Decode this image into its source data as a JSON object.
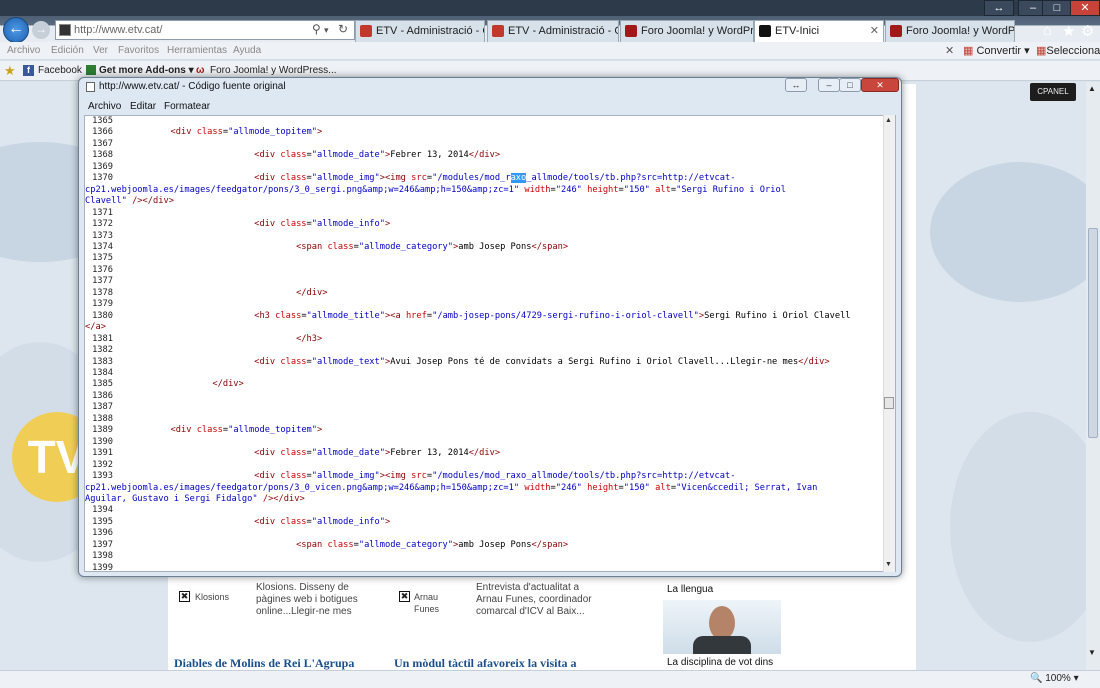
{
  "browser": {
    "address": "http://www.etv.cat/",
    "tabs": [
      {
        "label": "ETV - Administració - Ges...",
        "icon_color": "#c0392b",
        "active": false
      },
      {
        "label": "ETV - Administració - Ges...",
        "icon_color": "#c0392b",
        "active": false
      },
      {
        "label": "Foro Joomla! y WordPress...",
        "icon_color": "#a01818",
        "active": false
      },
      {
        "label": "ETV-Inici",
        "icon_color": "#111111",
        "active": true
      },
      {
        "label": "Foro Joomla! y WordPress...",
        "icon_color": "#a01818",
        "active": false
      }
    ],
    "menu": [
      "Archivo",
      "Edición",
      "Ver",
      "Favoritos",
      "Herramientas",
      "Ayuda"
    ],
    "favorites": [
      "Facebook",
      "Get more Add-ons ▾",
      "Foro Joomla! y WordPress..."
    ],
    "commands": {
      "convert": "Convertir ▾",
      "select": "Seleccionar"
    },
    "zoom": "100%"
  },
  "source_window": {
    "title": "http://www.etv.cat/ - Código fuente original",
    "menu": [
      "Archivo",
      "Editar",
      "Formatear"
    ],
    "lines": [
      {
        "n": "1365",
        "html": ""
      },
      {
        "n": "1366",
        "html": "        <span class=\"t\">&lt;div</span> <span class=\"a\">class</span>=<span class=\"v\">\"allmode_topitem\"</span><span class=\"t\">&gt;</span>"
      },
      {
        "n": "1367",
        "html": ""
      },
      {
        "n": "1368",
        "html": "                        <span class=\"t\">&lt;div</span> <span class=\"a\">class</span>=<span class=\"v\">\"allmode_date\"</span><span class=\"t\">&gt;</span>Febrer 13, 2014<span class=\"t\">&lt;/div&gt;</span>"
      },
      {
        "n": "1369",
        "html": ""
      },
      {
        "n": "1370",
        "html": "                        <span class=\"t\">&lt;div</span> <span class=\"a\">class</span>=<span class=\"v\">\"allmode_img\"</span><span class=\"t\">&gt;&lt;img</span> <span class=\"a\">src</span>=<span class=\"v\">\"/modules/mod_r<span class=\"sel\">axo</span>_allmode/tools/tb.php?src=http://etvcat-</span>"
      },
      {
        "n": "",
        "html": "<span class=\"v\">cp21.webjoomla.es/images/feedgator/pons/3_0_sergi.png&amp;amp;w=246&amp;amp;h=150&amp;amp;zc=1\"</span> <span class=\"a\">width</span>=<span class=\"v\">\"246\"</span> <span class=\"a\">height</span>=<span class=\"v\">\"150\"</span> <span class=\"a\">alt</span>=<span class=\"v\">\"Sergi Rufino i Oriol</span>"
      },
      {
        "n": "",
        "html": "<span class=\"v\">Clavell\"</span> <span class=\"t\">/&gt;&lt;/div&gt;</span>"
      },
      {
        "n": "1371",
        "html": ""
      },
      {
        "n": "1372",
        "html": "                        <span class=\"t\">&lt;div</span> <span class=\"a\">class</span>=<span class=\"v\">\"allmode_info\"</span><span class=\"t\">&gt;</span>"
      },
      {
        "n": "1373",
        "html": ""
      },
      {
        "n": "1374",
        "html": "                                <span class=\"t\">&lt;span</span> <span class=\"a\">class</span>=<span class=\"v\">\"allmode_category\"</span><span class=\"t\">&gt;</span>amb Josep Pons<span class=\"t\">&lt;/span&gt;</span>"
      },
      {
        "n": "1375",
        "html": ""
      },
      {
        "n": "1376",
        "html": ""
      },
      {
        "n": "1377",
        "html": ""
      },
      {
        "n": "1378",
        "html": "                                <span class=\"t\">&lt;/div&gt;</span>"
      },
      {
        "n": "1379",
        "html": ""
      },
      {
        "n": "1380",
        "html": "                        <span class=\"t\">&lt;h3</span> <span class=\"a\">class</span>=<span class=\"v\">\"allmode_title\"</span><span class=\"t\">&gt;&lt;a</span> <span class=\"a\">href</span>=<span class=\"v\">\"/amb-josep-pons/4729-sergi-rufino-i-oriol-clavell\"</span><span class=\"t\">&gt;</span>Sergi Rufino i Oriol Clavell"
      },
      {
        "n": "",
        "html": "<span class=\"t\">&lt;/a&gt;</span>"
      },
      {
        "n": "1381",
        "html": "                                <span class=\"t\">&lt;/h3&gt;</span>"
      },
      {
        "n": "1382",
        "html": ""
      },
      {
        "n": "1383",
        "html": "                        <span class=\"t\">&lt;div</span> <span class=\"a\">class</span>=<span class=\"v\">\"allmode_text\"</span><span class=\"t\">&gt;</span>Avui Josep Pons té de convidats a Sergi Rufino i Oriol Clavell...Llegir-ne mes<span class=\"t\">&lt;/div&gt;</span>"
      },
      {
        "n": "1384",
        "html": ""
      },
      {
        "n": "1385",
        "html": "                <span class=\"t\">&lt;/div&gt;</span>"
      },
      {
        "n": "1386",
        "html": ""
      },
      {
        "n": "1387",
        "html": ""
      },
      {
        "n": "1388",
        "html": ""
      },
      {
        "n": "1389",
        "html": "        <span class=\"t\">&lt;div</span> <span class=\"a\">class</span>=<span class=\"v\">\"allmode_topitem\"</span><span class=\"t\">&gt;</span>"
      },
      {
        "n": "1390",
        "html": ""
      },
      {
        "n": "1391",
        "html": "                        <span class=\"t\">&lt;div</span> <span class=\"a\">class</span>=<span class=\"v\">\"allmode_date\"</span><span class=\"t\">&gt;</span>Febrer 13, 2014<span class=\"t\">&lt;/div&gt;</span>"
      },
      {
        "n": "1392",
        "html": ""
      },
      {
        "n": "1393",
        "html": "                        <span class=\"t\">&lt;div</span> <span class=\"a\">class</span>=<span class=\"v\">\"allmode_img\"</span><span class=\"t\">&gt;&lt;img</span> <span class=\"a\">src</span>=<span class=\"v\">\"/modules/mod_raxo_allmode/tools/tb.php?src=http://etvcat-</span>"
      },
      {
        "n": "",
        "html": "<span class=\"v\">cp21.webjoomla.es/images/feedgator/pons/3_0_vicen.png&amp;amp;w=246&amp;amp;h=150&amp;amp;zc=1\"</span> <span class=\"a\">width</span>=<span class=\"v\">\"246\"</span> <span class=\"a\">height</span>=<span class=\"v\">\"150\"</span> <span class=\"a\">alt</span>=<span class=\"v\">\"Vicen&amp;ccedil; Serrat, Ivan</span>"
      },
      {
        "n": "",
        "html": "<span class=\"v\">Aguilar, Gustavo i Sergi Fidalgo\"</span> <span class=\"t\">/&gt;&lt;/div&gt;</span>"
      },
      {
        "n": "1394",
        "html": ""
      },
      {
        "n": "1395",
        "html": "                        <span class=\"t\">&lt;div</span> <span class=\"a\">class</span>=<span class=\"v\">\"allmode_info\"</span><span class=\"t\">&gt;</span>"
      },
      {
        "n": "1396",
        "html": ""
      },
      {
        "n": "1397",
        "html": "                                <span class=\"t\">&lt;span</span> <span class=\"a\">class</span>=<span class=\"v\">\"allmode_category\"</span><span class=\"t\">&gt;</span>amb Josep Pons<span class=\"t\">&lt;/span&gt;</span>"
      },
      {
        "n": "1398",
        "html": ""
      },
      {
        "n": "1399",
        "html": ""
      }
    ]
  },
  "page_behind": {
    "cpanel": "CPANEL",
    "items": [
      {
        "tag": "Klosions",
        "text": "Klosions. Disseny de pàgines web i botigues online...Llegir-ne mes"
      },
      {
        "tag": "Arnau Funes",
        "text": "Entrevista d'actualitat a Arnau Funes, coordinador comarcal d'ICV al Baix..."
      }
    ],
    "captions": [
      "La llengua",
      "La disciplina de vot dins"
    ],
    "headlines": [
      "Diables de Molins de Rei L'Agrupa",
      "Un mòdul tàctil afavoreix la visita a"
    ]
  }
}
